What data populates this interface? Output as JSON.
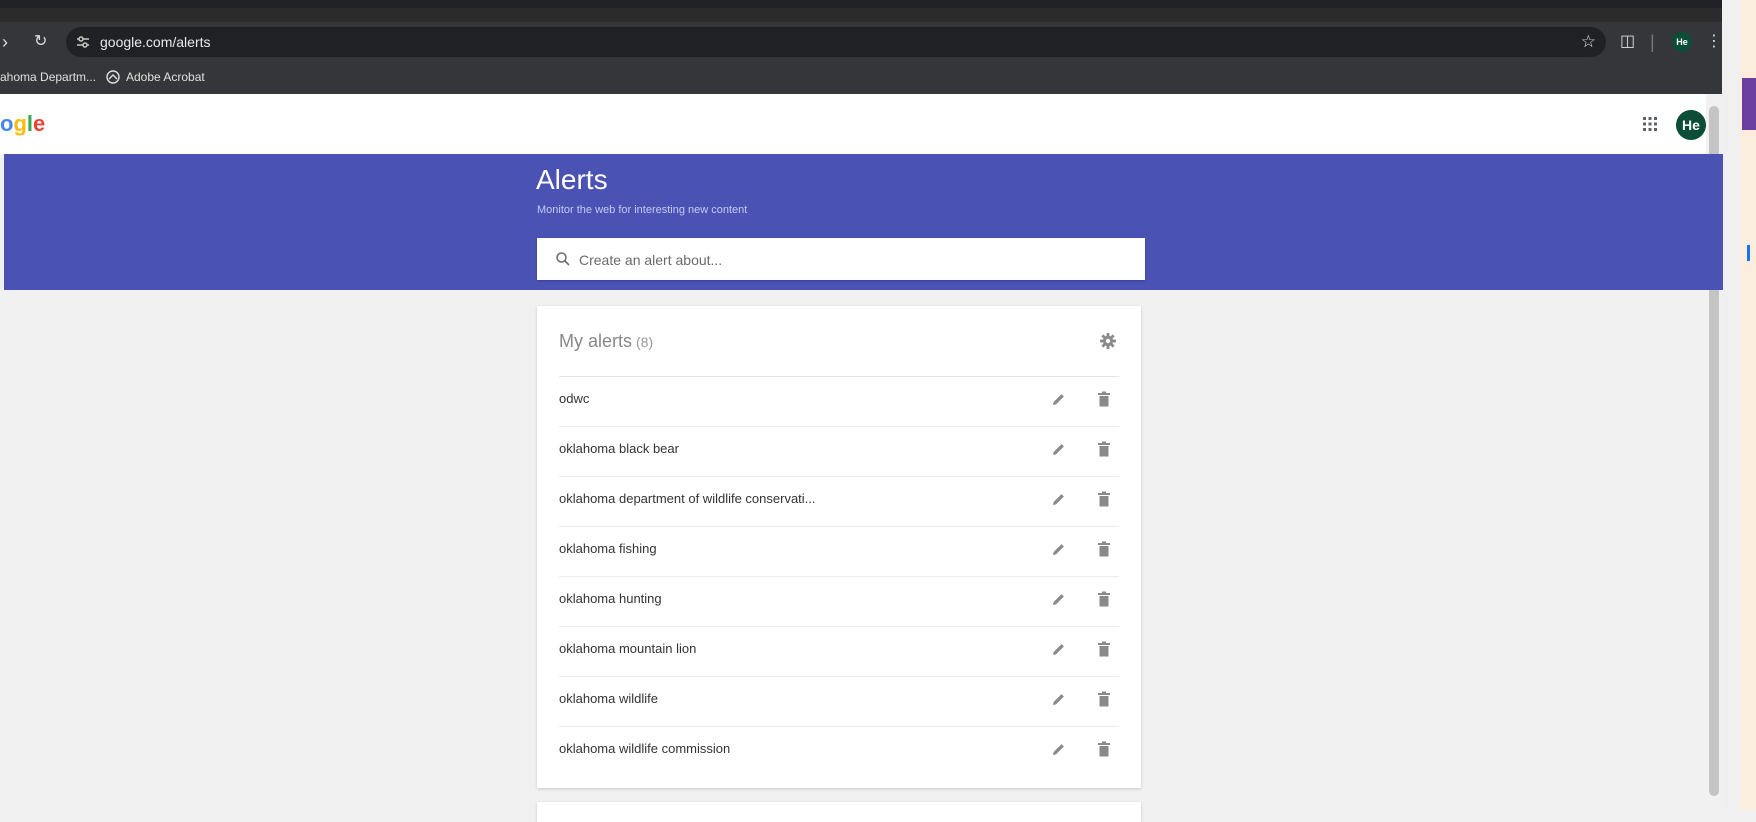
{
  "browser": {
    "url": "google.com/alerts",
    "bookmarks": [
      {
        "label": "ahoma Departm..."
      },
      {
        "label": "Adobe Acrobat"
      }
    ],
    "profile_initials": "He"
  },
  "header": {
    "logo_text": "ogle",
    "avatar_initials": "He"
  },
  "banner": {
    "title": "Alerts",
    "subtitle": "Monitor the web for interesting new content",
    "search_placeholder": "Create an alert about..."
  },
  "my_alerts": {
    "title": "My alerts",
    "count": "(8)",
    "items": [
      {
        "label": "odwc"
      },
      {
        "label": "oklahoma black bear"
      },
      {
        "label": "oklahoma department of wildlife conservati..."
      },
      {
        "label": "oklahoma fishing"
      },
      {
        "label": "oklahoma hunting"
      },
      {
        "label": "oklahoma mountain lion"
      },
      {
        "label": "oklahoma wildlife"
      },
      {
        "label": "oklahoma wildlife commission"
      }
    ]
  },
  "colors": {
    "banner": "#4a52b4",
    "avatar": "#0b4d36",
    "toolbar": "#35363a"
  }
}
